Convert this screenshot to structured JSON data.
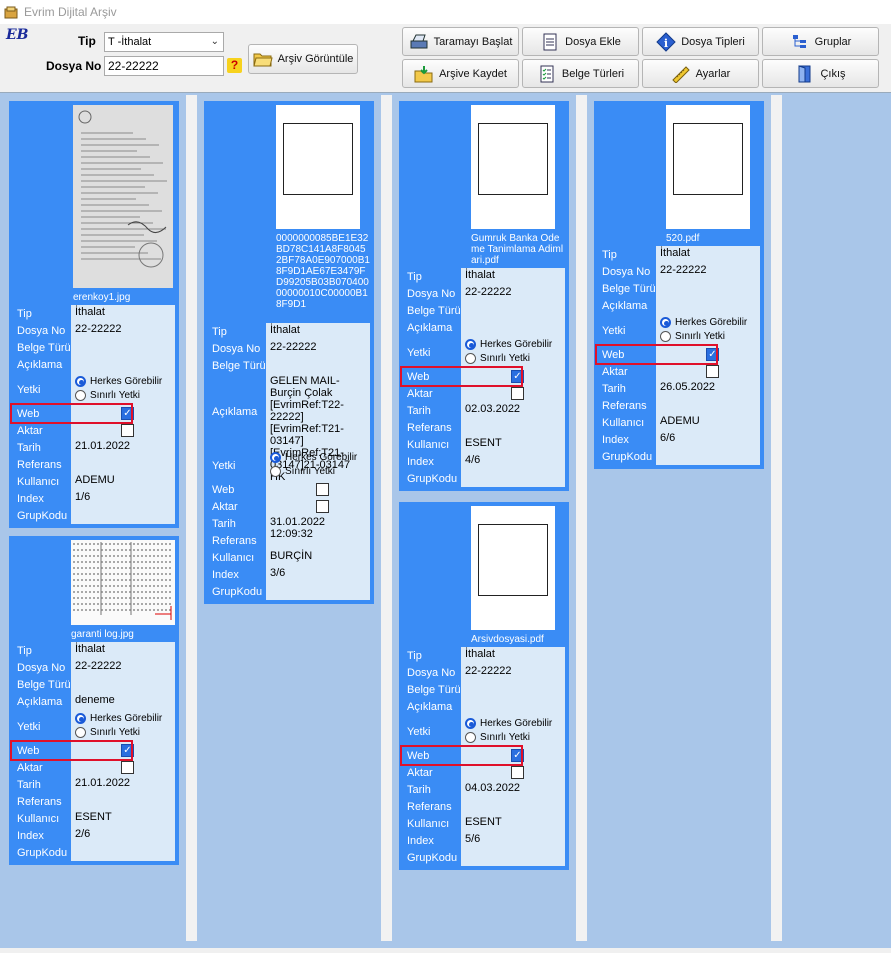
{
  "window": {
    "title": "Evrim Dijital Arşiv"
  },
  "form": {
    "logo": "EB",
    "tip_label": "Tip",
    "tip_value": "T  -İthalat",
    "dosya_label": "Dosya No",
    "dosya_value": "22-22222",
    "help_icon": "question-icon"
  },
  "buttons": {
    "arsiv_goruntule": "Arşiv Görüntüle",
    "tarama_baslat": "Taramayı Başlat",
    "dosya_ekle": "Dosya Ekle",
    "dosya_tipleri": "Dosya Tipleri",
    "gruplar": "Gruplar",
    "arsive_kaydet": "Arşive Kaydet",
    "belge_turleri": "Belge Türleri",
    "ayarlar": "Ayarlar",
    "cikis": "Çıkış"
  },
  "labels": {
    "tip": "Tip",
    "dosya_no": "Dosya No",
    "belge_turu": "Belge Türü",
    "aciklama": "Açıklama",
    "yetki": "Yetki",
    "herkes": "Herkes Görebilir",
    "sinirli": "Sınırlı Yetki",
    "web": "Web",
    "aktar": "Aktar",
    "tarih": "Tarih",
    "referans": "Referans",
    "kullanici": "Kullanıcı",
    "index": "Index",
    "grupkodu": "GrupKodu"
  },
  "cards": [
    {
      "filename": "erenkoy1.jpg",
      "tip": "İthalat",
      "dosya_no": "22-22222",
      "aciklama": "",
      "web": true,
      "aktar": false,
      "tarih": "21.01.2022",
      "kullanici": "ADEMU",
      "index": "1/6"
    },
    {
      "filename": "garanti log.jpg",
      "tip": "İthalat",
      "dosya_no": "22-22222",
      "aciklama": "deneme",
      "web": true,
      "aktar": false,
      "tarih": "21.01.2022",
      "kullanici": "ESENT",
      "index": "2/6"
    },
    {
      "filename": "0000000085BE1E32BD78C141A8F80452BF78A0E907000B18F9D1AE67E3479FD99205B03B07040000000010C00000B18F9D1",
      "tip": "İthalat",
      "dosya_no": "22-22222",
      "aciklama": "GELEN MAIL-Burçin Çolak [EvrimRef:T22-22222][EvrimRef:T21-03147][EvrimRef:T21-03147]21-03147 HK",
      "web": false,
      "aktar": false,
      "tarih": "31.01.2022 12:09:32",
      "kullanici": "BURÇİN",
      "index": "3/6"
    },
    {
      "filename": "Gumruk Banka Odeme Tanimlama Adimlari.pdf",
      "tip": "İthalat",
      "dosya_no": "22-22222",
      "aciklama": "",
      "web": true,
      "aktar": false,
      "tarih": "02.03.2022",
      "kullanici": "ESENT",
      "index": "4/6"
    },
    {
      "filename": "Arsivdosyasi.pdf",
      "tip": "İthalat",
      "dosya_no": "22-22222",
      "aciklama": "",
      "web": true,
      "aktar": false,
      "tarih": "04.03.2022",
      "kullanici": "ESENT",
      "index": "5/6"
    },
    {
      "filename": "520.pdf",
      "tip": "İthalat",
      "dosya_no": "22-22222",
      "aciklama": "",
      "web": true,
      "aktar": false,
      "tarih": "26.05.2022",
      "kullanici": "ADEMU",
      "index": "6/6"
    }
  ]
}
